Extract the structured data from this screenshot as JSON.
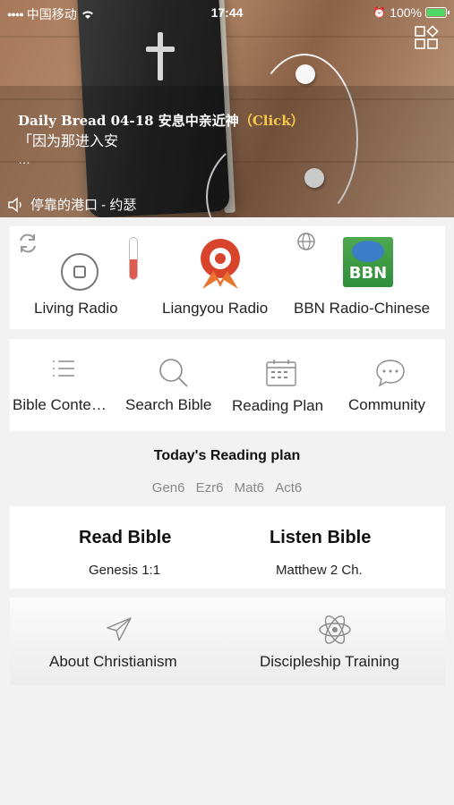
{
  "status_bar": {
    "carrier": "中国移动",
    "time": "17:44",
    "battery": "100%"
  },
  "hero": {
    "daily_bread": "Daily Bread 04-18 安息中亲近神",
    "click_label": "（Click）",
    "quote": "「因为那进入安",
    "ellipsis": "…",
    "now_playing": "停靠的港口 - 约瑟"
  },
  "radio": {
    "items": [
      {
        "label": "Living Radio"
      },
      {
        "label": "Liangyou Radio"
      },
      {
        "label": "BBN Radio-Chinese"
      }
    ],
    "bbn_logo_text": "BBN"
  },
  "tools": {
    "items": [
      {
        "label": "Bible Conte…",
        "icon": "list-icon"
      },
      {
        "label": "Search Bible",
        "icon": "search-icon"
      },
      {
        "label": "Reading Plan",
        "icon": "calendar-icon"
      },
      {
        "label": "Community",
        "icon": "chat-icon"
      }
    ]
  },
  "reading_plan": {
    "title": "Today's Reading plan",
    "items": [
      "Gen6",
      "Ezr6",
      "Mat6",
      "Act6"
    ]
  },
  "read_listen": {
    "read_title": "Read Bible",
    "read_sub": "Genesis 1:1",
    "listen_title": "Listen Bible",
    "listen_sub": "Matthew 2 Ch."
  },
  "bottom": {
    "items": [
      {
        "label": "About Christianism",
        "icon": "paper-plane-icon"
      },
      {
        "label": "Discipleship Training",
        "icon": "atom-icon"
      }
    ]
  },
  "colors": {
    "accent_gold": "#f6c84a",
    "liangyou_red": "#d8432c",
    "bbn_green": "#2f8f3a"
  }
}
